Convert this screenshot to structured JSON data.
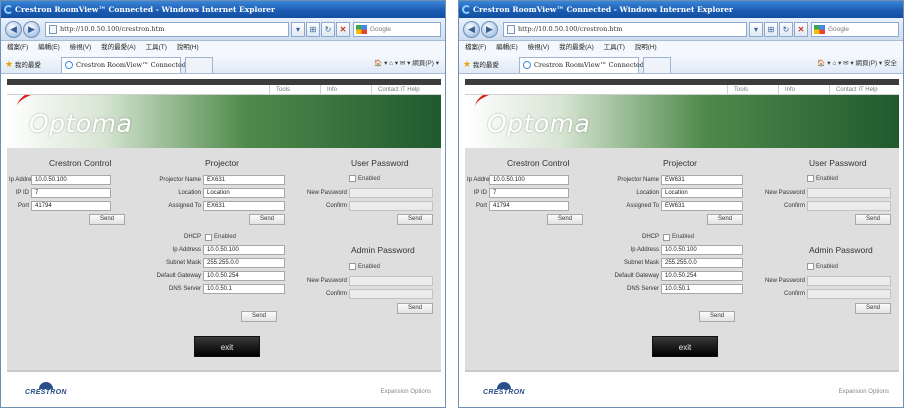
{
  "browser": {
    "title": "Crestron RoomView™ Connected - Windows Internet Explorer",
    "url": "http://10.0.50.100/crestron.htm",
    "search_placeholder": "Google",
    "menu": [
      "檔案(F)",
      "編輯(E)",
      "檢視(V)",
      "我的最愛(A)",
      "工具(T)",
      "說明(H)"
    ],
    "favorites_label": "我的最愛",
    "tab_title": "Crestron RoomView™ Connected",
    "toolbar_text_left": "▾ ⌂ ▾ ✉ ▾ 網頁(P) ▾",
    "toolbar_text_right": "▾ ⌂ ▾ ✉ ▾ 網頁(P) ▾ 安全"
  },
  "top_links": [
    "Tools",
    "Info",
    "Contact IT Help"
  ],
  "brand": {
    "logo": "Optoma"
  },
  "crestron_control": {
    "heading": "Crestron Control",
    "ip_address_label": "Ip Address",
    "ip_address": "10.0.50.100",
    "ip_id_label": "IP ID",
    "ip_id": "7",
    "port_label": "Port",
    "port": "41794",
    "send_label": "Send"
  },
  "projector": {
    "heading": "Projector",
    "name_label": "Projector Name",
    "location_label": "Location",
    "location": "Location",
    "assigned_label": "Assigned To",
    "send_label": "Send",
    "dhcp_label": "DHCP",
    "dhcp_enabled_label": "Enabled",
    "ip_label": "Ip Address",
    "ip": "10.0.50.100",
    "subnet_label": "Subnet Mask",
    "subnet": "255.255.0.0",
    "gateway_label": "Default Gateway",
    "gateway": "10.0.50.254",
    "dns_label": "DNS Server",
    "dns": "10.0.50.1",
    "send2_label": "Send"
  },
  "user_password": {
    "heading": "User Password",
    "enabled_label": "Enabled",
    "new_label": "New Password",
    "confirm_label": "Confirm",
    "send_label": "Send"
  },
  "admin_password": {
    "heading": "Admin Password",
    "enabled_label": "Enabled",
    "new_label": "New Password",
    "confirm_label": "Confirm",
    "send_label": "Send"
  },
  "exit_label": "exit",
  "footer": {
    "crestron": "CRESTRON",
    "expansion": "Expansion Options"
  },
  "windows": [
    {
      "projector_name": "EX631",
      "assigned_to": "EX631"
    },
    {
      "projector_name": "EW631",
      "assigned_to": "EW631"
    }
  ]
}
